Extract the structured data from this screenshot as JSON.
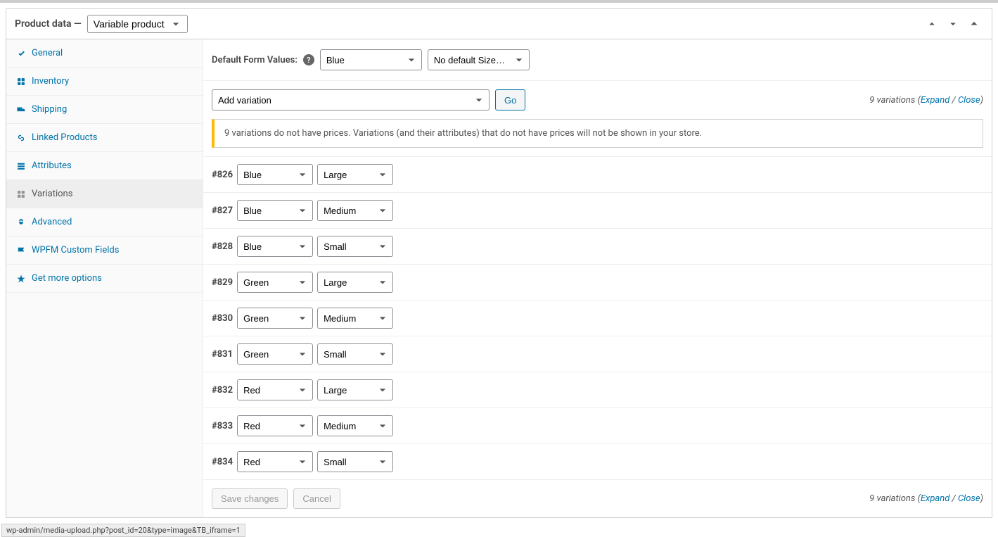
{
  "header": {
    "title": "Product data —",
    "product_type": "Variable product"
  },
  "tabs": [
    {
      "key": "general",
      "label": "General"
    },
    {
      "key": "inventory",
      "label": "Inventory"
    },
    {
      "key": "shipping",
      "label": "Shipping"
    },
    {
      "key": "linked",
      "label": "Linked Products"
    },
    {
      "key": "attributes",
      "label": "Attributes"
    },
    {
      "key": "variations",
      "label": "Variations"
    },
    {
      "key": "advanced",
      "label": "Advanced"
    },
    {
      "key": "wpfm",
      "label": "WPFM Custom Fields"
    },
    {
      "key": "more",
      "label": "Get more options"
    }
  ],
  "active_tab": "variations",
  "default_values": {
    "label": "Default Form Values:",
    "color": "Blue",
    "size": "No default Size…"
  },
  "toolbar": {
    "add_variation": "Add variation",
    "go": "Go",
    "count_prefix": "9 variations (",
    "expand": "Expand",
    "sep": " / ",
    "close": "Close",
    "count_suffix": ")"
  },
  "notice": "9 variations do not have prices. Variations (and their attributes) that do not have prices will not be shown in your store.",
  "variations": [
    {
      "id": "#826",
      "color": "Blue",
      "size": "Large"
    },
    {
      "id": "#827",
      "color": "Blue",
      "size": "Medium"
    },
    {
      "id": "#828",
      "color": "Blue",
      "size": "Small"
    },
    {
      "id": "#829",
      "color": "Green",
      "size": "Large"
    },
    {
      "id": "#830",
      "color": "Green",
      "size": "Medium"
    },
    {
      "id": "#831",
      "color": "Green",
      "size": "Small"
    },
    {
      "id": "#832",
      "color": "Red",
      "size": "Large"
    },
    {
      "id": "#833",
      "color": "Red",
      "size": "Medium"
    },
    {
      "id": "#834",
      "color": "Red",
      "size": "Small"
    }
  ],
  "footer": {
    "save": "Save changes",
    "cancel": "Cancel"
  },
  "status_bar": "wp-admin/media-upload.php?post_id=20&type=image&TB_iframe=1"
}
